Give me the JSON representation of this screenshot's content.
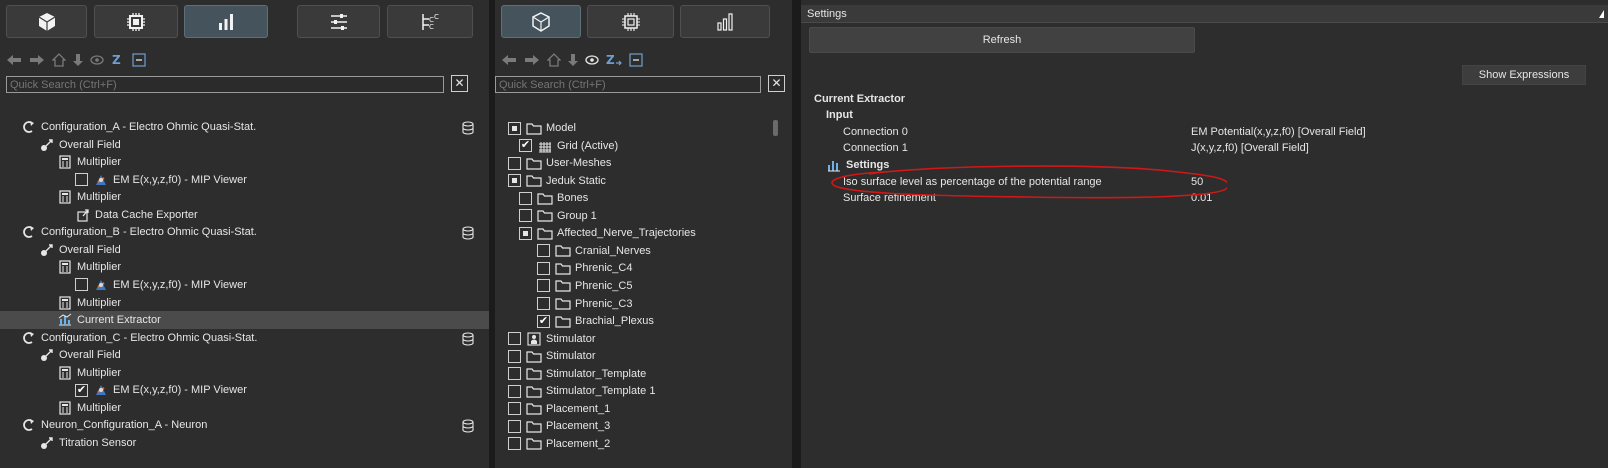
{
  "left": {
    "tabs": [
      "model-icon",
      "simulation-icon",
      "analysis-icon",
      "settings-sliders-icon",
      "tree-hierarchy-icon"
    ],
    "search": {
      "placeholder": "Quick Search (Ctrl+F)",
      "clear": "✕"
    },
    "tree": [
      {
        "label": "Configuration_A - Electro Ohmic Quasi-Stat.",
        "level": 0,
        "arrow": "◢",
        "icon": "algorithm-icon",
        "db": true
      },
      {
        "label": "Overall Field",
        "level": 1,
        "arrow": "◢",
        "icon": "field-icon"
      },
      {
        "label": "Multiplier",
        "level": 2,
        "arrow": "◢",
        "icon": "calculator-icon"
      },
      {
        "label": "EM E(x,y,z,f0) - MIP Viewer",
        "level": 3,
        "checkbox": "unchecked",
        "icon": "viewer-icon"
      },
      {
        "label": "Multiplier",
        "level": 2,
        "arrow": "◢",
        "icon": "calculator-icon"
      },
      {
        "label": "Data Cache Exporter",
        "level": 3,
        "icon": "exporter-icon"
      },
      {
        "label": "Configuration_B - Electro Ohmic Quasi-Stat.",
        "level": 0,
        "arrow": "◢",
        "icon": "algorithm-icon",
        "db": true
      },
      {
        "label": "Overall Field",
        "level": 1,
        "arrow": "◢",
        "icon": "field-icon"
      },
      {
        "label": "Multiplier",
        "level": 2,
        "arrow": "◢",
        "icon": "calculator-icon"
      },
      {
        "label": "EM E(x,y,z,f0) - MIP Viewer",
        "level": 3,
        "checkbox": "unchecked",
        "icon": "viewer-icon"
      },
      {
        "label": "Multiplier",
        "level": 2,
        "arrow": "▷",
        "icon": "calculator-icon"
      },
      {
        "label": "Current Extractor",
        "level": 2,
        "icon": "extractor-icon",
        "selected": true
      },
      {
        "label": "Configuration_C - Electro Ohmic Quasi-Stat.",
        "level": 0,
        "arrow": "◢",
        "icon": "algorithm-icon",
        "db": true
      },
      {
        "label": "Overall Field",
        "level": 1,
        "arrow": "◢",
        "icon": "field-icon"
      },
      {
        "label": "Multiplier",
        "level": 2,
        "arrow": "◢",
        "icon": "calculator-icon"
      },
      {
        "label": "EM E(x,y,z,f0) - MIP Viewer",
        "level": 3,
        "checkbox": "checked",
        "icon": "viewer-icon"
      },
      {
        "label": "Multiplier",
        "level": 2,
        "arrow": "▷",
        "icon": "calculator-icon"
      },
      {
        "label": "Neuron_Configuration_A - Neuron",
        "level": 0,
        "arrow": "◢",
        "icon": "algorithm-icon",
        "db": true
      },
      {
        "label": "Titration Sensor",
        "level": 1,
        "arrow": "◢",
        "icon": "field-icon"
      }
    ]
  },
  "middle": {
    "tabs": [
      "model-icon",
      "simulation-icon",
      "analysis-icon"
    ],
    "search": {
      "placeholder": "Quick Search (Ctrl+F)",
      "clear": "✕"
    },
    "tree": [
      {
        "label": "Model",
        "level": 0,
        "checkbox": "partial",
        "icon": "folder-icon"
      },
      {
        "label": "Grid (Active)",
        "level": 1,
        "checkbox": "checked",
        "icon": "grid-icon"
      },
      {
        "label": "User-Meshes",
        "level": 0,
        "arrow": "▷",
        "checkbox": "unchecked",
        "icon": "folder-icon"
      },
      {
        "label": "Jeduk Static",
        "level": 0,
        "arrow": "◢",
        "checkbox": "partial",
        "icon": "folder-icon"
      },
      {
        "label": "Bones",
        "level": 1,
        "arrow": "▷",
        "checkbox": "unchecked",
        "icon": "folder-icon"
      },
      {
        "label": "Group 1",
        "level": 1,
        "arrow": "▷",
        "checkbox": "unchecked",
        "icon": "folder-icon"
      },
      {
        "label": "Affected_Nerve_Trajectories",
        "level": 1,
        "arrow": "◢",
        "checkbox": "partial",
        "icon": "folder-icon"
      },
      {
        "label": "Cranial_Nerves",
        "level": 2,
        "arrow": "▷",
        "checkbox": "unchecked",
        "icon": "folder-icon"
      },
      {
        "label": "Phrenic_C4",
        "level": 2,
        "arrow": "▷",
        "checkbox": "unchecked",
        "icon": "folder-icon"
      },
      {
        "label": "Phrenic_C5",
        "level": 2,
        "arrow": "▷",
        "checkbox": "unchecked",
        "icon": "folder-icon"
      },
      {
        "label": "Phrenic_C3",
        "level": 2,
        "arrow": "▷",
        "checkbox": "unchecked",
        "icon": "folder-icon"
      },
      {
        "label": "Brachial_Plexus",
        "level": 2,
        "arrow": "▷",
        "checkbox": "checked",
        "icon": "folder-icon"
      },
      {
        "label": "Stimulator",
        "level": 0,
        "checkbox": "unchecked",
        "icon": "person-icon"
      },
      {
        "label": "Stimulator",
        "level": 0,
        "arrow": "▷",
        "checkbox": "unchecked",
        "icon": "folder-icon"
      },
      {
        "label": "Stimulator_Template",
        "level": 0,
        "arrow": "▷",
        "checkbox": "unchecked",
        "icon": "folder-icon"
      },
      {
        "label": "Stimulator_Template 1",
        "level": 0,
        "arrow": "▷",
        "checkbox": "unchecked",
        "icon": "folder-icon"
      },
      {
        "label": "Placement_1",
        "level": 0,
        "arrow": "▷",
        "checkbox": "unchecked",
        "icon": "folder-icon"
      },
      {
        "label": "Placement_3",
        "level": 0,
        "arrow": "▷",
        "checkbox": "unchecked",
        "icon": "folder-icon"
      },
      {
        "label": "Placement_2",
        "level": 0,
        "arrow": "▷",
        "checkbox": "unchecked",
        "icon": "folder-icon"
      }
    ]
  },
  "right": {
    "title": "Settings",
    "refresh_label": "Refresh",
    "show_expressions_label": "Show Expressions",
    "properties": [
      {
        "label": "Current Extractor",
        "level": 0,
        "arrow": "◢",
        "bold": true,
        "value": ""
      },
      {
        "label": "Input",
        "level": 1,
        "arrow": "◢",
        "bold": true,
        "value": ""
      },
      {
        "label": "Connection 0",
        "level": 2,
        "value": "EM Potential(x,y,z,f0) [Overall Field]"
      },
      {
        "label": "Connection 1",
        "level": 2,
        "value": "J(x,y,z,f0) [Overall Field]"
      },
      {
        "label": "Settings",
        "level": 1,
        "arrow": "◢",
        "bold": true,
        "icon": "settings-bars-icon",
        "value": ""
      },
      {
        "label": "Iso surface level as percentage of the potential range",
        "level": 2,
        "value": "50"
      },
      {
        "label": "Surface refinement",
        "level": 2,
        "value": "0.01"
      }
    ],
    "annotation_color": "#d01818"
  }
}
